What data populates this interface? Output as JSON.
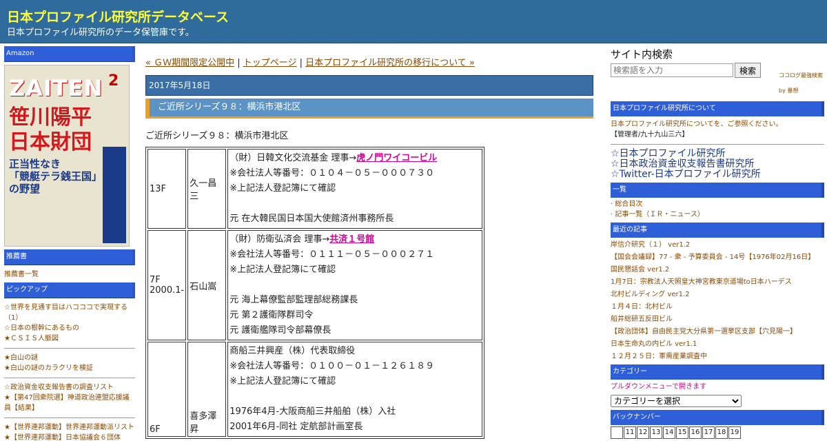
{
  "header": {
    "title": "日本プロファイル研究所データベース",
    "description": "日本プロファイル研究所のデータ保管庫です。"
  },
  "left": {
    "amazon_label": "Amazon",
    "ad": {
      "logo": "ZAITEN",
      "issue": "2",
      "headline_1": "笹川陽平",
      "headline_2": "日本財団",
      "sub_1": "正当性なき",
      "sub_2": "「競艇テラ銭王国」",
      "sub_3": "の野望"
    },
    "recommend_label": "推薦書",
    "recommend_link": "推薦書一覧",
    "pickup_label": "ピックアップ",
    "pickup_items": [
      "☆世界を見通す目はハコココで実現する（1）",
      "☆日本の根幹にあるもの",
      "★ＣＳＩＳ人脈図"
    ],
    "group2": [
      "★白山の謎",
      "★白山の謎のカラクリを検証"
    ],
    "group3": [
      "☆政治資金収支報告書の調査リスト",
      "★【第47回衆院選】神道政治連盟応援議員【結果】"
    ],
    "group4": [
      "★【世界連邦運動】世界連邦運動派リスト",
      "★【世界連邦運動】日本協議会６団体"
    ]
  },
  "main": {
    "crumb_prev": "« ＧＷ期間限定公開中",
    "crumb_sep1": " | ",
    "crumb_top": "トップページ",
    "crumb_sep2": " | ",
    "crumb_next": "日本プロファイル研究所の移行について »",
    "date": "2017年5月18日",
    "post_title": "ご近所シリーズ９８：横浜市港北区",
    "post_lead": "ご近所シリーズ９８：横浜市港北区",
    "rows": [
      {
        "floor": "13F",
        "floor2": "",
        "name": "久一昌三",
        "line1_prefix": "（財）日韓文化交流基金 理事→",
        "line1_link": "虎ノ門ワイコービル",
        "line2": "※会社法人等番号：０１０４－０５－０００７３０",
        "line3": "※上記法人登記簿にて確認",
        "line4": "",
        "line5": "元 在大韓民国日本国大使館済州事務所長",
        "line6": "",
        "line7": ""
      },
      {
        "floor": "7F",
        "floor2": "2000.1-",
        "name": "石山嵩",
        "line1_prefix": "（財）防衛弘済会 理事→",
        "line1_link": "共済１号館",
        "line2": "※会社法人等番号：０１１１－０５－０００２７１",
        "line3": "※上記法人登記簿にて確認",
        "line4": "",
        "line5": "元 海上幕僚監部監理部総務課長",
        "line6": "元 第２護衛隊群司令",
        "line7": "元 護衛艦隊司令部幕僚長"
      },
      {
        "floor": "6F",
        "floor2": "",
        "name": "喜多澤昇",
        "line1_prefix": "商船三井興産（株）代表取締役",
        "line1_link": "",
        "line2": "※会社法人等番号：０１００－０１－１２６１８９",
        "line3": "※上記法人登記簿にて確認",
        "line4": "",
        "line5": "1976年4月-大阪商船三井船舶（株）入社",
        "line6": "2001年6月-同社 定航部計画室長",
        "line7": ""
      }
    ]
  },
  "right": {
    "search_title": "サイト内検索",
    "search_placeholder": "検索語を入力",
    "search_button": "検索",
    "search_credit": "ココログ最強検索 by 暴想",
    "about_label": "日本プロファイル研究所について",
    "about_text": "日本プロファイル研究所についてを、ご参照ください。",
    "admin_text": "【管理者/九十九山三六】",
    "big_links": [
      "☆日本プロファイル研究所",
      "☆日本政治資金収支報告書研究所",
      "☆Twitter-日本プロファイル研究所"
    ],
    "list_label": "一覧",
    "list_items": [
      "· 総合目次",
      "· 記事一覧（ＩＲ・ニュース）"
    ],
    "recent_label": "最近の記事",
    "recent_items": [
      "岸信介研究（１） ver1.2",
      "【国会会議録】77 - 衆 - 予算委員会 - 14号【1976年02月16日】",
      "国民懇話会 ver1.2",
      "1月7日：宗教法人天照皇大神宮教東京道場to日本ハーデス",
      "北村ビルディング ver1.2",
      "１月４日：北村ビル",
      "船井総研五反田ビル",
      "【政治団体】自由民主党大分県第一選挙区支部【穴見陽一】",
      "日本生命丸の内ビル ver1.1",
      "１２月２５日：軍需産業調査中"
    ],
    "category_label": "カテゴリー",
    "category_hint": "プルダウンメニューで開きます",
    "category_select": "カテゴリーを選択",
    "backnumber_label": "バックナンバー",
    "backnumbers": [
      "",
      "11",
      "12",
      "13",
      "14",
      "15",
      "16",
      "17",
      "18",
      "19"
    ]
  },
  "colors": {
    "header_bg": "#2f6b9c",
    "title_yellow": "#ffff33",
    "bar_blue": "#2e5fd8",
    "link_brown": "#8a4a00",
    "link_pink": "#d4009a",
    "accent_orange": "#f0a020"
  }
}
